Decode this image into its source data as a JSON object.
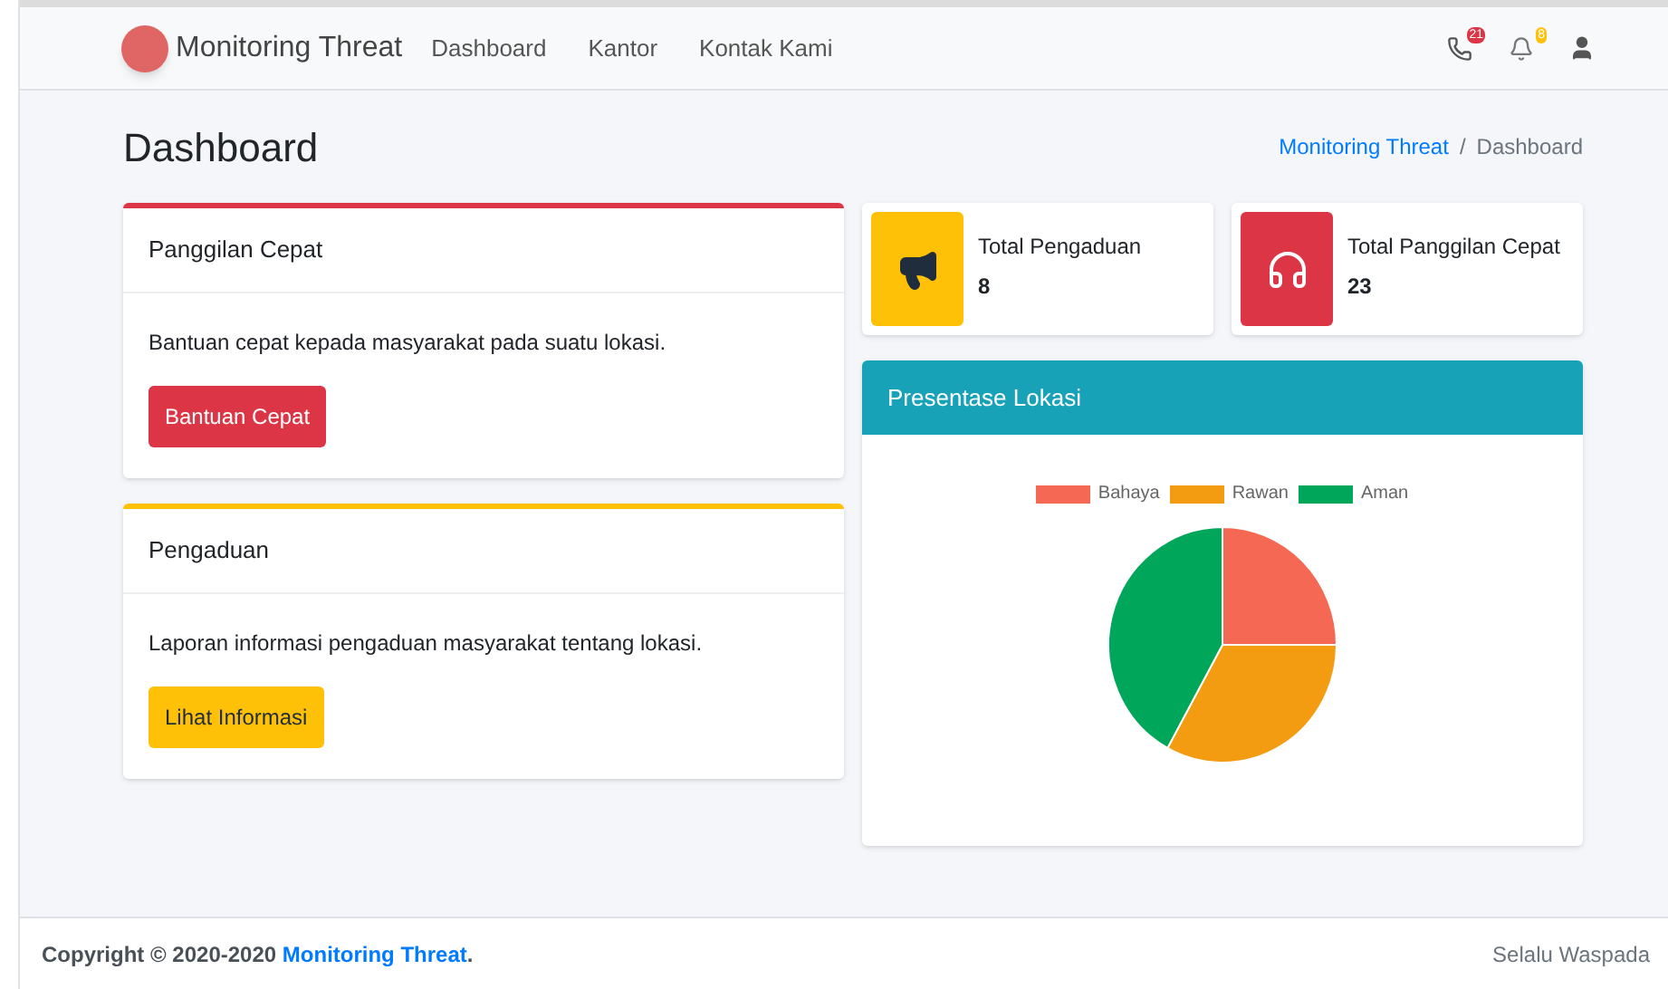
{
  "navbar": {
    "brand": "Monitoring Threat",
    "links": [
      "Dashboard",
      "Kantor",
      "Kontak Kami"
    ],
    "badges": [
      {
        "kind": "phone",
        "count": "21",
        "color": "#dc3545"
      },
      {
        "kind": "bell",
        "count": "8",
        "color": "#ffc107"
      }
    ]
  },
  "header": {
    "title": "Dashboard",
    "breadcrumb_separator": "/",
    "breadcrumb": [
      {
        "label": "Monitoring Threat",
        "link": true
      },
      {
        "label": "Dashboard",
        "link": false
      }
    ]
  },
  "cards": [
    {
      "title": "Panggilan Cepat",
      "text": "Bantuan cepat kepada masyarakat pada suatu lokasi.",
      "button": "Bantuan Cepat",
      "color": "#dc3545"
    },
    {
      "title": "Pengaduan",
      "text": "Laporan informasi pengaduan masyarakat tentang lokasi.",
      "button": "Lihat Informasi",
      "color": "#ffc107"
    }
  ],
  "stats": [
    {
      "kind": "megaphone",
      "label": "Total Pengaduan",
      "value": "8",
      "color": "#ffc107"
    },
    {
      "kind": "headset",
      "label": "Total Panggilan Cepat",
      "value": "23",
      "color": "#dc3545"
    }
  ],
  "chart_panel": {
    "title": "Presentase Lokasi",
    "chart_data": {
      "type": "pie",
      "categories": [
        "Bahaya",
        "Rawan",
        "Aman"
      ],
      "values": [
        25,
        33,
        42
      ],
      "colors": [
        "#f56954",
        "#f39c12",
        "#00a65a"
      ]
    }
  },
  "footer": {
    "copyright": "Copyright © 2020-2020",
    "brand": "Monitoring Threat",
    "end": ".",
    "tagline": "Selalu Waspada"
  }
}
